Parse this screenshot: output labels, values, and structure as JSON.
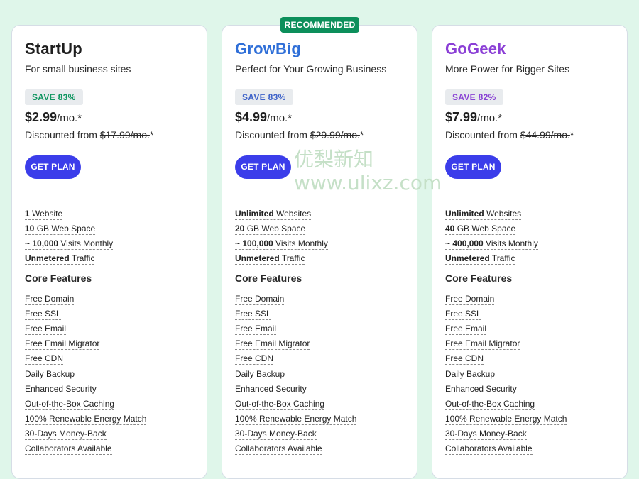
{
  "recommended_label": "RECOMMENDED",
  "watermark": {
    "line1": "优梨新知",
    "line2": "www.ulixz.com"
  },
  "plans": [
    {
      "name": "StartUp",
      "name_color": "#1f1f1f",
      "subtitle": "For small business sites",
      "save": "SAVE 83%",
      "save_color": "#0f9560",
      "save_bg": "#e8ebee",
      "price": "$2.99",
      "price_unit": "/mo.*",
      "discount_prefix": "Discounted from ",
      "discount_old": "$17.99/mo.",
      "discount_suffix": "*",
      "button": "GET PLAN",
      "specs": [
        {
          "strong": "1",
          "rest": " Website"
        },
        {
          "strong": "10",
          "rest": " GB Web Space"
        },
        {
          "strong": "~ 10,000",
          "rest": " Visits Monthly"
        },
        {
          "strong": "Unmetered",
          "rest": " Traffic"
        }
      ],
      "core_title": "Core Features",
      "features": [
        "Free Domain",
        "Free SSL",
        "Free Email",
        "Free Email Migrator",
        "Free CDN",
        "Daily Backup",
        "Enhanced Security",
        "Out-of-the-Box Caching",
        "100% Renewable Energy Match",
        "30-Days Money-Back",
        "Collaborators Available"
      ]
    },
    {
      "name": "GrowBig",
      "name_color": "#2f6fd8",
      "subtitle": "Perfect for Your Growing Business",
      "save": "SAVE 83%",
      "save_color": "#3f63c9",
      "save_bg": "#e8ebee",
      "price": "$4.99",
      "price_unit": "/mo.*",
      "discount_prefix": "Discounted from ",
      "discount_old": "$29.99/mo.",
      "discount_suffix": "*",
      "button": "GET PLAN",
      "specs": [
        {
          "strong": "Unlimited",
          "rest": " Websites"
        },
        {
          "strong": "20",
          "rest": " GB Web Space"
        },
        {
          "strong": "~ 100,000",
          "rest": " Visits Monthly"
        },
        {
          "strong": "Unmetered",
          "rest": " Traffic"
        }
      ],
      "core_title": "Core Features",
      "features": [
        "Free Domain",
        "Free SSL",
        "Free Email",
        "Free Email Migrator",
        "Free CDN",
        "Daily Backup",
        "Enhanced Security",
        "Out-of-the-Box Caching",
        "100% Renewable Energy Match",
        "30-Days Money-Back",
        "Collaborators Available"
      ]
    },
    {
      "name": "GoGeek",
      "name_color": "#8b3fd6",
      "subtitle": "More Power for Bigger Sites",
      "save": "SAVE 82%",
      "save_color": "#8a44d4",
      "save_bg": "#e8ebee",
      "price": "$7.99",
      "price_unit": "/mo.*",
      "discount_prefix": "Discounted from ",
      "discount_old": "$44.99/mo.",
      "discount_suffix": "*",
      "button": "GET PLAN",
      "specs": [
        {
          "strong": "Unlimited",
          "rest": " Websites"
        },
        {
          "strong": "40",
          "rest": " GB Web Space"
        },
        {
          "strong": "~ 400,000",
          "rest": " Visits Monthly"
        },
        {
          "strong": "Unmetered",
          "rest": " Traffic"
        }
      ],
      "core_title": "Core Features",
      "features": [
        "Free Domain",
        "Free SSL",
        "Free Email",
        "Free Email Migrator",
        "Free CDN",
        "Daily Backup",
        "Enhanced Security",
        "Out-of-the-Box Caching",
        "100% Renewable Energy Match",
        "30-Days Money-Back",
        "Collaborators Available"
      ]
    }
  ]
}
